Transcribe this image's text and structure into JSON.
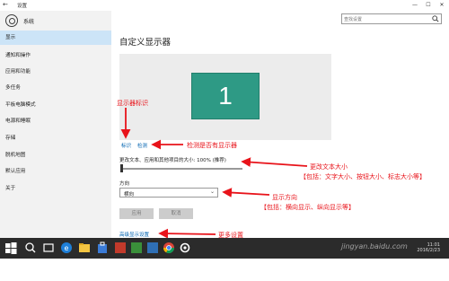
{
  "window": {
    "back_icon": "back-arrow-icon",
    "title": "设置",
    "minimize": "—",
    "maximize": "☐",
    "close": "✕"
  },
  "sidebar": {
    "home_icon": "gear-icon",
    "home_label": "系统",
    "items": [
      {
        "label": "显示",
        "active": true
      },
      {
        "label": "通知和操作",
        "active": false
      },
      {
        "label": "应用和功能",
        "active": false
      },
      {
        "label": "多任务",
        "active": false
      },
      {
        "label": "平板电脑模式",
        "active": false
      },
      {
        "label": "电源和睡眠",
        "active": false
      },
      {
        "label": "存储",
        "active": false
      },
      {
        "label": "脱机地图",
        "active": false
      },
      {
        "label": "默认应用",
        "active": false
      },
      {
        "label": "关于",
        "active": false
      }
    ]
  },
  "search": {
    "placeholder": "查找设置",
    "icon": "search-icon"
  },
  "main": {
    "title": "自定义显示器",
    "monitor_number": "1",
    "identify_link": "标识",
    "detect_link": "检测",
    "scale_label": "更改文本、应用和其他项目的大小: 100% (推荐)",
    "scale_value_percent": 100,
    "orientation_label": "方向",
    "orientation_value": "横向",
    "apply_button": "应用",
    "cancel_button": "取消",
    "advanced_link": "高级显示设置"
  },
  "annotations": {
    "identify": "显示器标识",
    "detect": "检测是否有显示器",
    "scale_title": "更改文本大小",
    "scale_detail": "【包括：文字大小、按钮大小、标志大小等】",
    "orient_title": "显示方向",
    "orient_detail": "【包括：横向显示、纵向显示等】",
    "more": "更多设置"
  },
  "taskbar": {
    "start_icon": "windows-start-icon",
    "search_icon": "search-icon",
    "task_view_icon": "task-view-icon",
    "edge_icon": "edge-browser-icon",
    "explorer_icon": "file-explorer-icon",
    "store_icon": "store-icon",
    "app_icons": [
      "app-icon",
      "app-icon",
      "app-icon",
      "app-icon",
      "chrome-icon",
      "settings-icon"
    ],
    "clock_time": "11:01",
    "clock_date": "2016/2/23",
    "watermark": "jingyan.baidu.com"
  },
  "colors": {
    "accent": "#0063b1",
    "active_nav": "#cce4f7",
    "monitor": "#2e9a85",
    "annotation": "#e8131a",
    "taskbar": "#2b2b2b"
  }
}
